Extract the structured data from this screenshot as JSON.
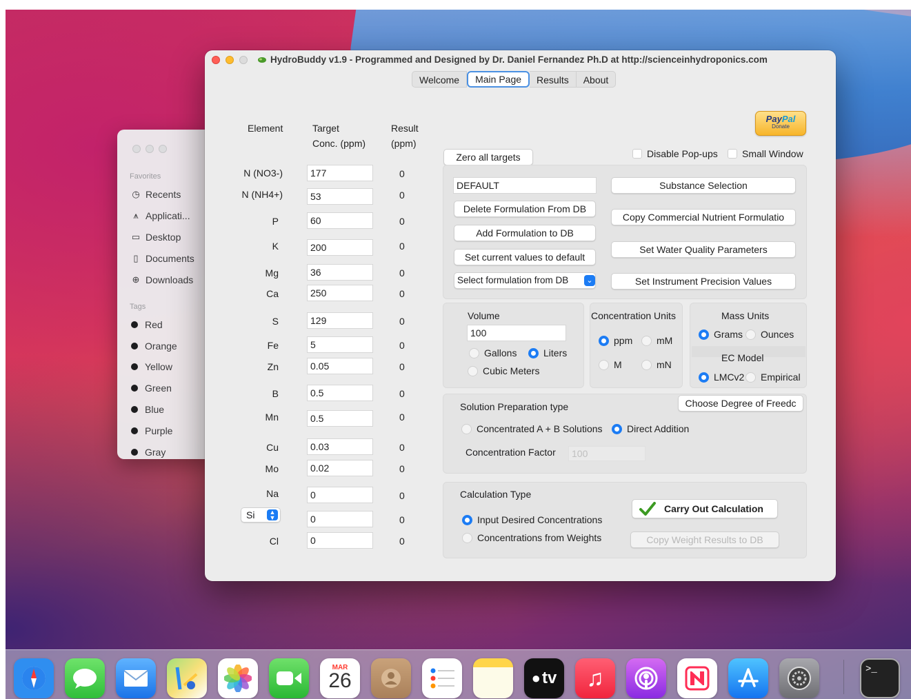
{
  "finder": {
    "favorites_heading": "Favorites",
    "favorites": [
      {
        "label": "Recents",
        "icon": "clock-icon"
      },
      {
        "label": "Applicati...",
        "icon": "applications-icon"
      },
      {
        "label": "Desktop",
        "icon": "desktop-icon"
      },
      {
        "label": "Documents",
        "icon": "document-icon"
      },
      {
        "label": "Downloads",
        "icon": "download-icon"
      }
    ],
    "tags_heading": "Tags",
    "tags": [
      "Red",
      "Orange",
      "Yellow",
      "Green",
      "Blue",
      "Purple",
      "Gray"
    ]
  },
  "window": {
    "title": "HydroBuddy v1.9 - Programmed and Designed by Dr. Daniel Fernandez Ph.D at http://scienceinhydroponics.com",
    "tabs": [
      "Welcome",
      "Main Page",
      "Results",
      "About"
    ],
    "active_tab": "Main Page"
  },
  "elements_table": {
    "headers": {
      "element": "Element",
      "target_line1": "Target",
      "target_line2": "Conc. (ppm)",
      "result_line1": "Result",
      "result_line2": "(ppm)"
    },
    "rows": [
      {
        "element": "N (NO3-)",
        "target": "177",
        "result": "0"
      },
      {
        "element": "N (NH4+)",
        "target": "53",
        "result": "0"
      },
      {
        "element": "P",
        "target": "60",
        "result": "0"
      },
      {
        "element": "K",
        "target": "200",
        "result": "0"
      },
      {
        "element": "Mg",
        "target": "36",
        "result": "0"
      },
      {
        "element": "Ca",
        "target": "250",
        "result": "0"
      },
      {
        "element": "S",
        "target": "129",
        "result": "0"
      },
      {
        "element": "Fe",
        "target": "5",
        "result": "0"
      },
      {
        "element": "Zn",
        "target": "0.05",
        "result": "0"
      },
      {
        "element": "B",
        "target": "0.5",
        "result": "0"
      },
      {
        "element": "Mn",
        "target": "0.5",
        "result": "0"
      },
      {
        "element": "Cu",
        "target": "0.03",
        "result": "0"
      },
      {
        "element": "Mo",
        "target": "0.02",
        "result": "0"
      },
      {
        "element": "Na",
        "target": "0",
        "result": "0"
      },
      {
        "element": "Si",
        "target": "0",
        "result": "0"
      },
      {
        "element": "Cl",
        "target": "0",
        "result": "0"
      }
    ],
    "extra_element_select": "Si"
  },
  "paypal": {
    "brand_pay": "Pay",
    "brand_pal": "Pal",
    "caption": "Donate"
  },
  "controls": {
    "zero_all_targets": "Zero all targets",
    "disable_popups": "Disable Pop-ups",
    "small_window": "Small Window",
    "formulation_name": "DEFAULT",
    "delete_formulation": "Delete Formulation From DB",
    "add_formulation": "Add Formulation to DB",
    "set_defaults": "Set current values to default",
    "select_formulation": "Select formulation from DB",
    "substance_selection": "Substance Selection",
    "copy_commercial": "Copy Commercial Nutrient Formulatio",
    "water_quality": "Set Water Quality Parameters",
    "instrument_precision": "Set Instrument Precision Values"
  },
  "volume": {
    "heading": "Volume",
    "value": "100",
    "options": [
      "Gallons",
      "Liters",
      "Cubic Meters"
    ],
    "selected": "Liters"
  },
  "concentration_units": {
    "heading": "Concentration Units",
    "options": [
      "ppm",
      "mM",
      "M",
      "mN"
    ],
    "selected": "ppm"
  },
  "mass_units": {
    "heading": "Mass Units",
    "options": [
      "Grams",
      "Ounces"
    ],
    "selected": "Grams"
  },
  "ec_model": {
    "heading": "EC Model",
    "options": [
      "LMCv2",
      "Empirical"
    ],
    "selected": "LMCv2"
  },
  "solution_prep": {
    "heading": "Solution Preparation type",
    "choose_button": "Choose Degree of Freedc",
    "options": [
      "Concentrated A + B Solutions",
      "Direct Addition"
    ],
    "selected": "Direct Addition",
    "factor_label": "Concentration Factor",
    "factor_value": "100"
  },
  "calculation": {
    "heading": "Calculation Type",
    "options": [
      "Input Desired Concentrations",
      "Concentrations from  Weights"
    ],
    "selected": "Input Desired Concentrations",
    "carry_out": "Carry Out Calculation",
    "copy_weights": "Copy Weight Results to DB"
  },
  "dock": {
    "calendar_month": "MAR",
    "calendar_day": "26",
    "tv_label": "tv",
    "apps": [
      "Safari",
      "Messages",
      "Mail",
      "Maps",
      "Photos",
      "FaceTime",
      "Calendar",
      "Contacts",
      "Reminders",
      "Notes",
      "TV",
      "Music",
      "Podcasts",
      "News",
      "App Store",
      "System Preferences",
      "Terminal"
    ]
  }
}
